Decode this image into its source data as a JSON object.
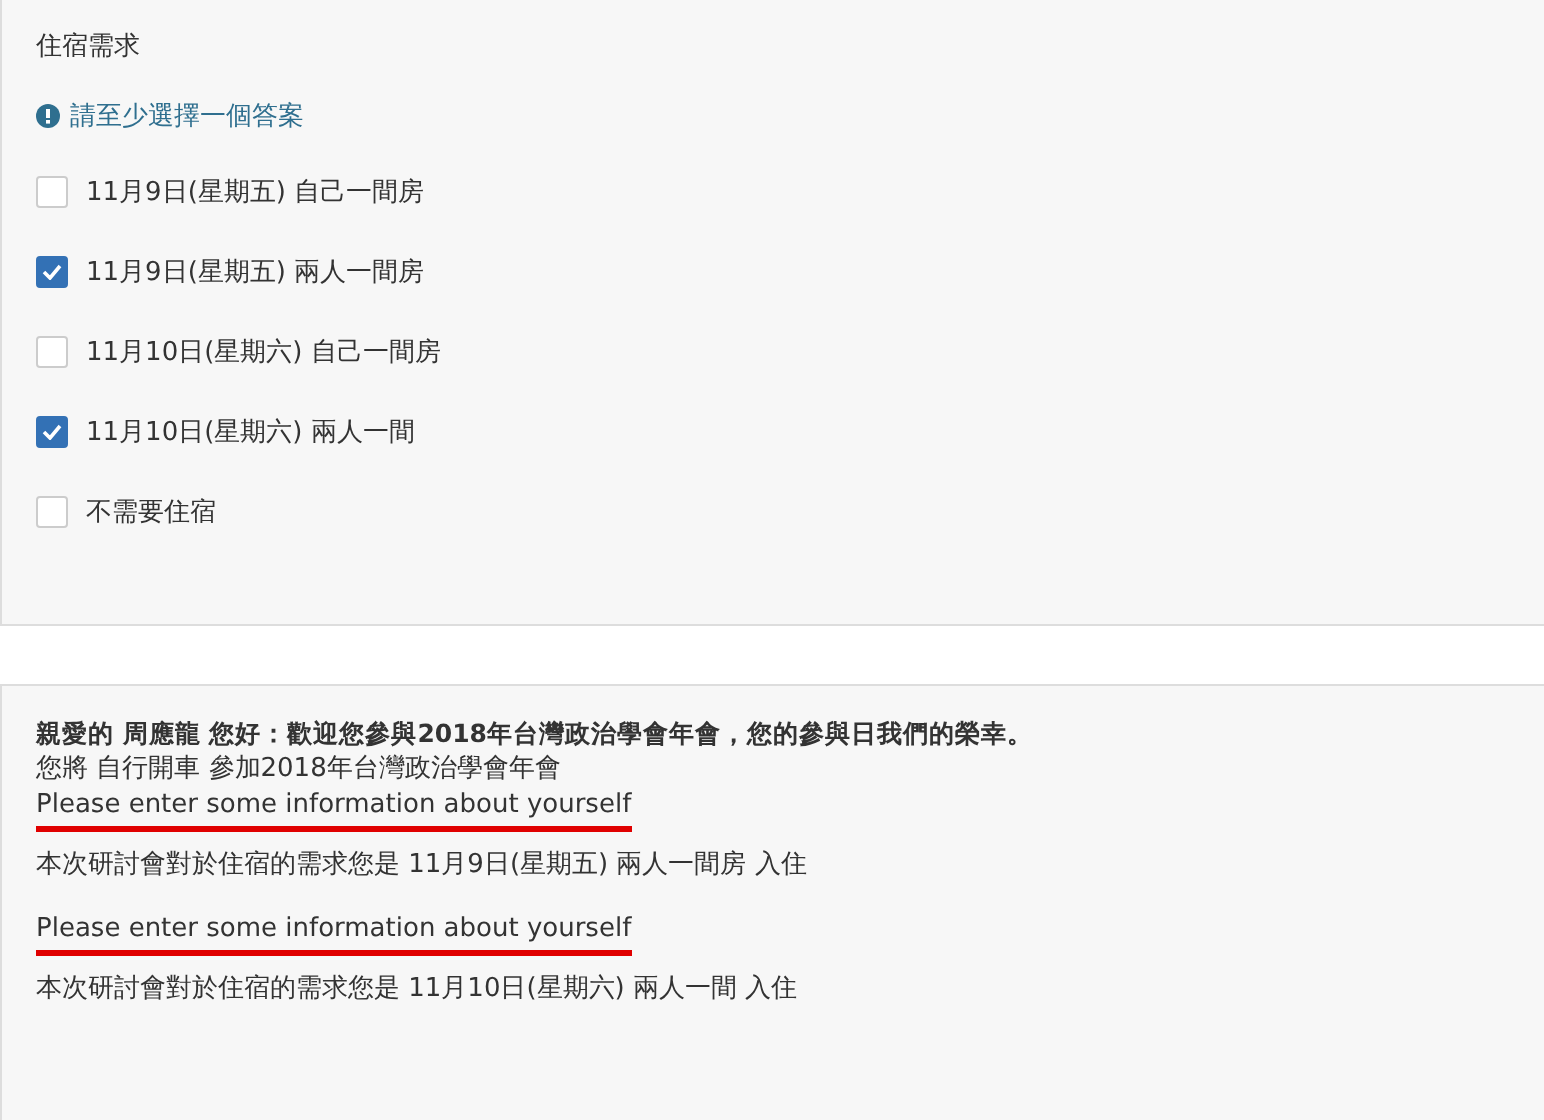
{
  "question": {
    "title": "住宿需求",
    "warning": "請至少選擇一個答案",
    "options": [
      {
        "label": "11月9日(星期五) 自己一間房",
        "checked": false
      },
      {
        "label": "11月9日(星期五) 兩人一間房",
        "checked": true
      },
      {
        "label": "11月10日(星期六) 自己一間房",
        "checked": false
      },
      {
        "label": "11月10日(星期六) 兩人一間",
        "checked": true
      },
      {
        "label": "不需要住宿",
        "checked": false
      }
    ]
  },
  "summary": {
    "lines": [
      {
        "text": "親愛的 周應龍 您好：歡迎您參與2018年台灣政治學會年會，您的參與日我們的榮幸。",
        "bold": true,
        "underlined": false
      },
      {
        "text": "您將 自行開車 參加2018年台灣政治學會年會",
        "bold": false,
        "underlined": false
      },
      {
        "text": "Please enter some information about yourself",
        "bold": false,
        "underlined": true
      },
      {
        "text": "本次研討會對於住宿的需求您是 11月9日(星期五) 兩人一間房 入住",
        "bold": false,
        "underlined": false
      },
      {
        "text": "Please enter some information about yourself",
        "bold": false,
        "underlined": true
      },
      {
        "text": "本次研討會對於住宿的需求您是 11月10日(星期六) 兩人一間 入住",
        "bold": false,
        "underlined": false
      }
    ]
  }
}
